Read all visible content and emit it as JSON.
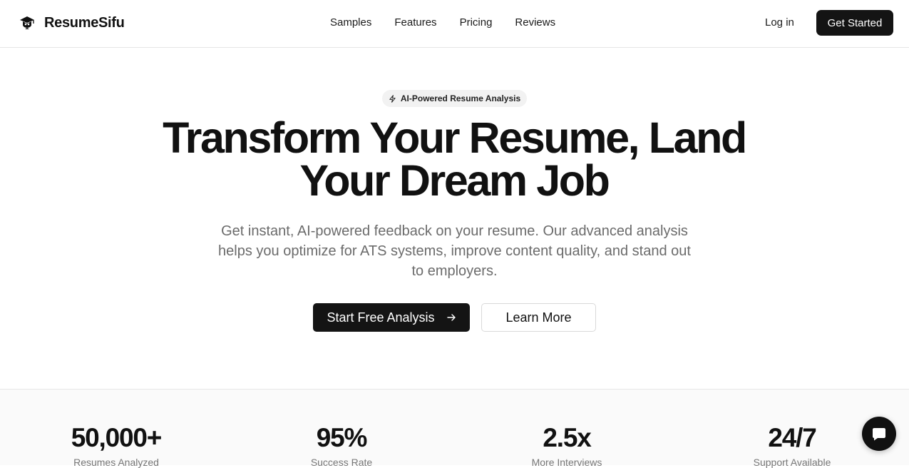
{
  "brand": {
    "name": "ResumeSifu",
    "icon": "graduation-cap-icon"
  },
  "nav": {
    "items": [
      {
        "label": "Samples"
      },
      {
        "label": "Features"
      },
      {
        "label": "Pricing"
      },
      {
        "label": "Reviews"
      }
    ],
    "login_label": "Log in",
    "cta_label": "Get Started"
  },
  "hero": {
    "badge": {
      "icon": "lightning-bolt-icon",
      "text": "AI-Powered Resume Analysis"
    },
    "title_line1": "Transform Your Resume, Land",
    "title_line2": "Your Dream Job",
    "subtitle": "Get instant, AI-powered feedback on your resume. Our advanced analysis helps you optimize for ATS systems, improve content quality, and stand out to employers.",
    "primary_button": {
      "label": "Start Free Analysis",
      "icon": "arrow-right-icon"
    },
    "secondary_button": {
      "label": "Learn More"
    }
  },
  "stats": [
    {
      "value": "50,000+",
      "label": "Resumes Analyzed"
    },
    {
      "value": "95%",
      "label": "Success Rate"
    },
    {
      "value": "2.5x",
      "label": "More Interviews"
    },
    {
      "value": "24/7",
      "label": "Support Available"
    }
  ],
  "chat": {
    "icon": "chat-bubble-icon"
  },
  "colors": {
    "primary": "#141414",
    "text": "#111111",
    "muted": "#6b6b6b",
    "badge_bg": "#f2f2f2",
    "stats_bg": "#fafafa",
    "border": "#e6e6e6"
  }
}
